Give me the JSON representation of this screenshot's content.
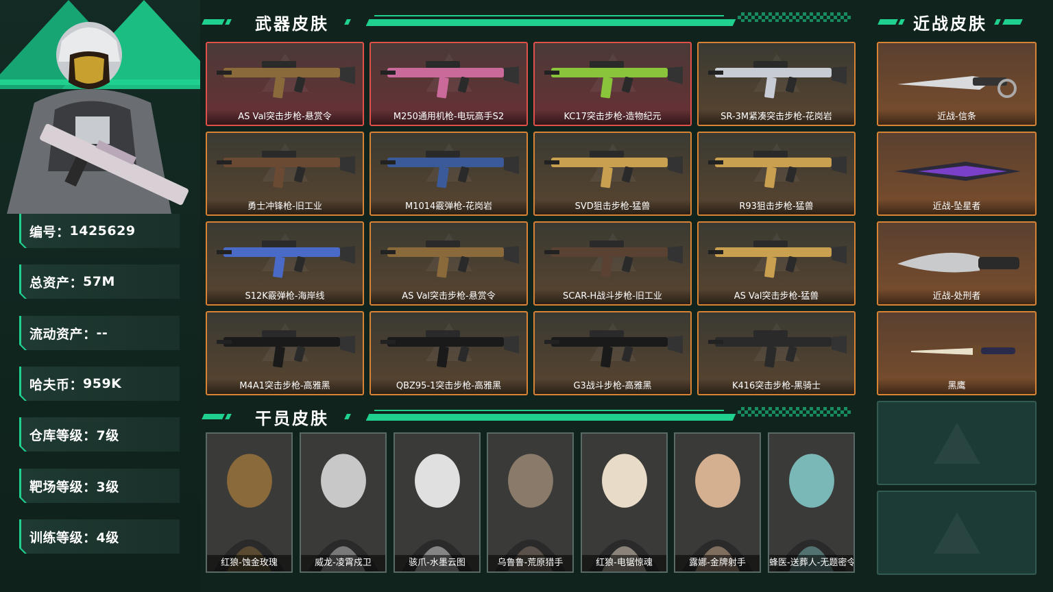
{
  "profile": {
    "stats": [
      {
        "label": "编号：",
        "value": "1425629"
      },
      {
        "label": "总资产：",
        "value": "57M"
      },
      {
        "label": "流动资产：",
        "value": "--"
      },
      {
        "label": "哈夫币：",
        "value": "959K"
      },
      {
        "label": "仓库等级：",
        "value": "7级"
      },
      {
        "label": "靶场等级：",
        "value": "3级"
      },
      {
        "label": "训练等级：",
        "value": "4级"
      }
    ]
  },
  "sections": {
    "weapons_title": "武器皮肤",
    "operators_title": "干员皮肤",
    "melee_title": "近战皮肤"
  },
  "weapons": [
    {
      "name": "AS Val突击步枪-悬赏令",
      "rarity": "red",
      "color": "#8a6a3a"
    },
    {
      "name": "M250通用机枪-电玩高手S2",
      "rarity": "red",
      "color": "#c96a9a"
    },
    {
      "name": "KC17突击步枪-造物纪元",
      "rarity": "red",
      "color": "#8ac43a"
    },
    {
      "name": "SR-3M紧凑突击步枪-花岗岩",
      "rarity": "orange",
      "color": "#c8ccd4"
    },
    {
      "name": "勇士冲锋枪-旧工业",
      "rarity": "orange",
      "color": "#6a4a32"
    },
    {
      "name": "M1014霰弹枪-花岗岩",
      "rarity": "orange",
      "color": "#3a5a9a"
    },
    {
      "name": "SVD狙击步枪-猛兽",
      "rarity": "orange",
      "color": "#c8a050"
    },
    {
      "name": "R93狙击步枪-猛兽",
      "rarity": "orange",
      "color": "#c8a050"
    },
    {
      "name": "S12K霰弹枪-海岸线",
      "rarity": "orange",
      "color": "#4a6ac8"
    },
    {
      "name": "AS Val突击步枪-悬赏令",
      "rarity": "orange",
      "color": "#8a6a3a"
    },
    {
      "name": "SCAR-H战斗步枪-旧工业",
      "rarity": "orange",
      "color": "#5a4232"
    },
    {
      "name": "AS Val突击步枪-猛兽",
      "rarity": "orange",
      "color": "#c8a050"
    },
    {
      "name": "M4A1突击步枪-高雅黑",
      "rarity": "orange",
      "color": "#1a1a1a"
    },
    {
      "name": "QBZ95-1突击步枪-高雅黑",
      "rarity": "orange",
      "color": "#1a1a1a"
    },
    {
      "name": "G3战斗步枪-高雅黑",
      "rarity": "orange",
      "color": "#1a1a1a"
    },
    {
      "name": "K416突击步枪-黑骑士",
      "rarity": "orange",
      "color": "#2a2a2a"
    }
  ],
  "operators": [
    {
      "name": "红狼-蚀金玫瑰",
      "color": "#8a6a3a"
    },
    {
      "name": "威龙-凌霄戍卫",
      "color": "#c8c8c8"
    },
    {
      "name": "骇爪-水墨云图",
      "color": "#e0e0e0"
    },
    {
      "name": "乌鲁鲁-荒原猎手",
      "color": "#8a7a6a"
    },
    {
      "name": "红狼-电锯惊魂",
      "color": "#e8dcc8"
    },
    {
      "name": "露娜-金牌射手",
      "color": "#d4b090"
    },
    {
      "name": "蜂医-送葬人-无题密令",
      "color": "#7ab8b8"
    }
  ],
  "melee": [
    {
      "name": "近战-信条"
    },
    {
      "name": "近战-坠星者"
    },
    {
      "name": "近战-处刑者"
    },
    {
      "name": "黑鹰"
    }
  ]
}
